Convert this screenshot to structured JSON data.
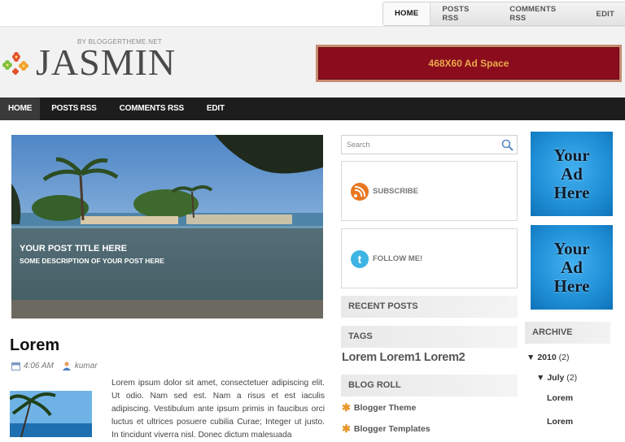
{
  "top_nav": [
    "HOME",
    "POSTS RSS",
    "COMMENTS RSS",
    "EDIT"
  ],
  "header": {
    "byline": "BY BLOGGERTHEME.NET",
    "logo": "JASMIN",
    "ad_banner": "468X60 Ad Space"
  },
  "main_nav": [
    "HOME",
    "POSTS RSS",
    "COMMENTS RSS",
    "EDIT"
  ],
  "slide": {
    "title": "YOUR POST TITLE HERE",
    "description": "SOME DESCRIPTION OF YOUR POST HERE"
  },
  "post": {
    "title": "Lorem",
    "time": "4:06 AM",
    "author": "kumar",
    "text": "Lorem ipsum dolor sit amet, consectetuer adipiscing elit. Ut odio. Nam sed est. Nam a risus et est iaculis adipiscing. Vestibulum ante ipsum primis in faucibus orci luctus et ultrices posuere cubilia Curae; Integer ut justo. In tincidunt viverra nisl. Donec dictum malesuada"
  },
  "sidebar": {
    "search_placeholder": "Search",
    "subscribe": "SUBSCRIBE",
    "follow": "FOLLOW ME!",
    "recent_posts": "RECENT POSTS",
    "tags_title": "TAGS",
    "tags": "Lorem Lorem1 Lorem2",
    "blogroll_title": "BLOG ROLL",
    "blogroll": [
      "Blogger Theme",
      "Blogger Templates"
    ]
  },
  "right": {
    "ad_text": [
      "Your",
      "Ad",
      "Here"
    ],
    "archive_title": "ARCHIVE",
    "year": "2010",
    "year_count": "(2)",
    "month": "July",
    "month_count": "(2)",
    "posts": [
      "Lorem",
      "Lorem"
    ]
  },
  "colors": {
    "nav_bg": "#1d1d1d",
    "ad_banner": "#8b0d1d",
    "ad_text": "#e9a94d",
    "accent_star": "#e8972a"
  }
}
